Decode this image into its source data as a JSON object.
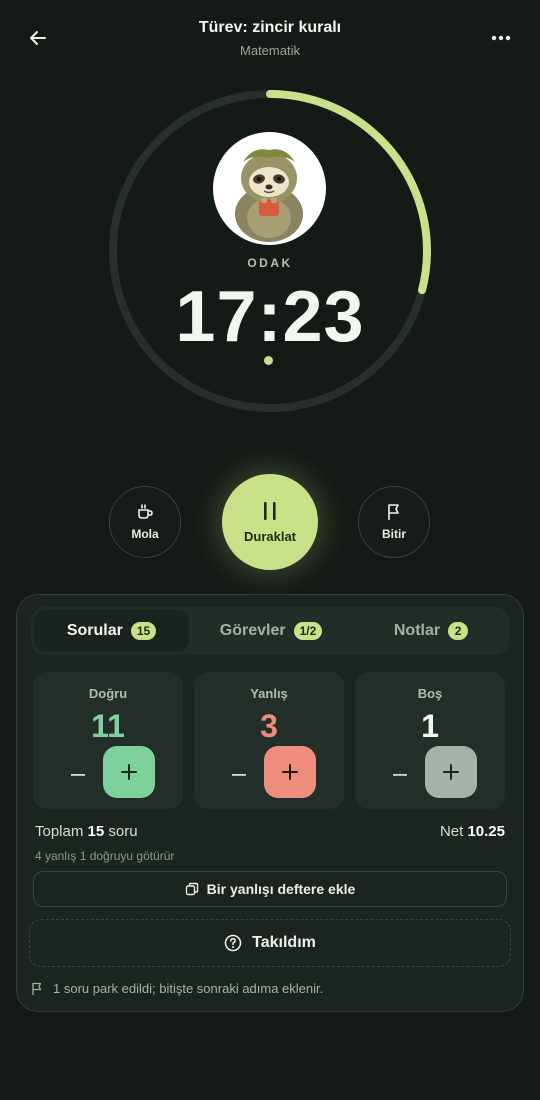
{
  "header": {
    "title": "Türev: zincir kuralı",
    "subtitle": "Matematik"
  },
  "timer": {
    "mode_label": "ODAK",
    "time": "17:23",
    "progress": 0.29,
    "ring_color": "#c9e28a",
    "track_color": "#27302b",
    "avatar": "sloth-mascot"
  },
  "controls": {
    "break_label": "Mola",
    "pause_label": "Duraklat",
    "finish_label": "Bitir"
  },
  "tabs": [
    {
      "label": "Sorular",
      "count": "15",
      "active": true
    },
    {
      "label": "Görevler",
      "count": "1/2",
      "active": false
    },
    {
      "label": "Notlar",
      "count": "2",
      "active": false
    }
  ],
  "counters": [
    {
      "label": "Doğru",
      "value": "11",
      "color": "#7fd19b"
    },
    {
      "label": "Yanlış",
      "value": "3",
      "color": "#ee8d7e"
    },
    {
      "label": "Boş",
      "value": "1",
      "color": "#f2f5ef"
    }
  ],
  "summary": {
    "total_prefix": "Toplam",
    "total_value": "15",
    "total_suffix": "soru",
    "net_label": "Net",
    "net_value": "10.25",
    "rule_text": "4 yanlış 1 doğruyu götürür"
  },
  "actions": {
    "add_wrong_label": "Bir yanlışı deftere ekle",
    "stuck_label": "Takıldım",
    "park_note": "1 soru park edildi; bitişte sonraki adıma eklenir."
  },
  "icons": {
    "back": "arrow-left-icon",
    "more": "more-horizontal-icon",
    "break": "coffee-cup-icon",
    "pause": "pause-icon",
    "finish": "flag-icon",
    "add": "copy-icon",
    "stuck": "question-circle-icon",
    "park": "flag-icon"
  }
}
